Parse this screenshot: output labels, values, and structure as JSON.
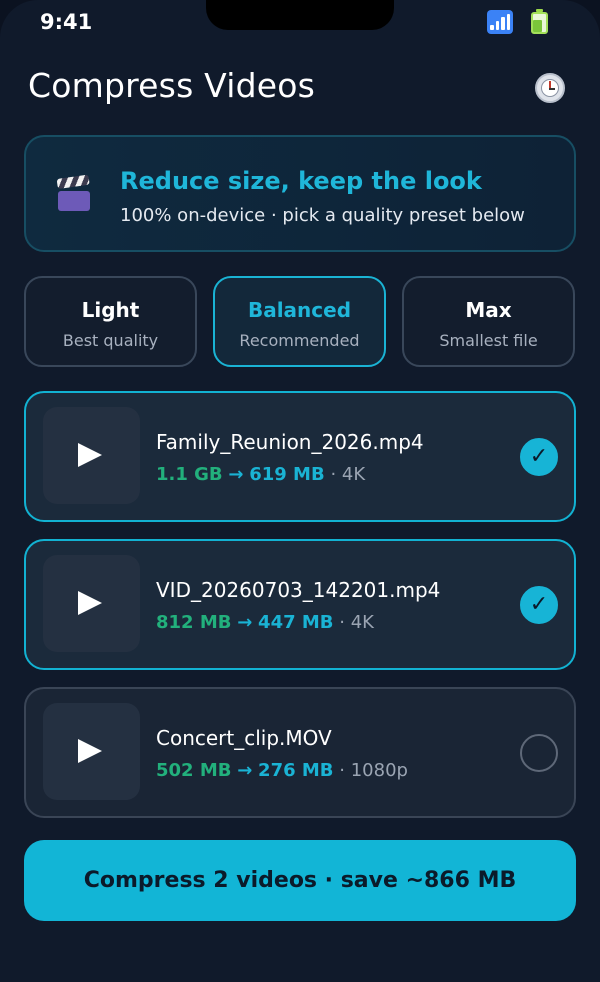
{
  "status_bar": {
    "time": "9:41"
  },
  "header": {
    "title": "Compress Videos",
    "history_icon": "clock-icon"
  },
  "hero": {
    "icon": "clapperboard-icon",
    "title": "Reduce size, keep the look",
    "subtitle": "100% on-device · pick a quality preset below"
  },
  "presets": [
    {
      "title": "Light",
      "subtitle": "Best quality",
      "selected": false
    },
    {
      "title": "Balanced",
      "subtitle": "Recommended",
      "selected": true
    },
    {
      "title": "Max",
      "subtitle": "Smallest file",
      "selected": false
    }
  ],
  "videos": [
    {
      "name": "Family_Reunion_2026.mp4",
      "from": "1.1 GB",
      "arrow": "→",
      "to": "619 MB",
      "sep": "·",
      "resolution": "4K",
      "selected": true
    },
    {
      "name": "VID_20260703_142201.mp4",
      "from": "812 MB",
      "arrow": "→",
      "to": "447 MB",
      "sep": "·",
      "resolution": "4K",
      "selected": true
    },
    {
      "name": "Concert_clip.MOV",
      "from": "502 MB",
      "arrow": "→",
      "to": "276 MB",
      "sep": "·",
      "resolution": "1080p",
      "selected": false
    }
  ],
  "check_glyph": "✓",
  "cta": {
    "label": "Compress 2 videos · save ~866 MB"
  },
  "colors": {
    "accent": "#1ab3d4",
    "savings_green": "#22b07c",
    "background": "#101a2b"
  }
}
